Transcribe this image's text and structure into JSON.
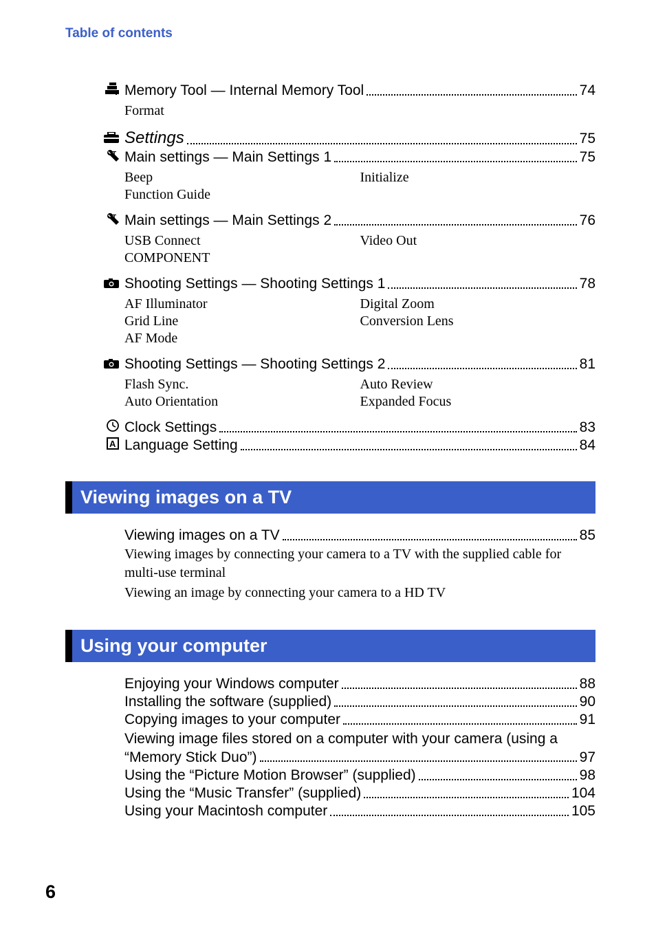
{
  "header": "Table of contents",
  "entries": [
    {
      "icon": "memory",
      "title": "Memory Tool — Internal Memory Tool",
      "page": "74",
      "subs_left": [
        "Format"
      ],
      "subs_right": []
    },
    {
      "icon": "toolbox",
      "title": "Settings",
      "page": "75",
      "italic": true
    },
    {
      "icon": "wrench",
      "title": "Main settings — Main Settings 1",
      "page": "75",
      "subs_left": [
        "Beep",
        "Function Guide"
      ],
      "subs_right": [
        "Initialize"
      ]
    },
    {
      "icon": "wrench",
      "title": "Main settings — Main Settings 2",
      "page": "76",
      "subs_left": [
        "USB Connect",
        "COMPONENT"
      ],
      "subs_right": [
        "Video Out"
      ]
    },
    {
      "icon": "camera",
      "title": "Shooting Settings — Shooting Settings 1",
      "page": "78",
      "subs_left": [
        "AF Illuminator",
        "Grid Line",
        "AF Mode"
      ],
      "subs_right": [
        "Digital Zoom",
        "Conversion Lens"
      ]
    },
    {
      "icon": "camera",
      "title": "Shooting Settings — Shooting Settings 2",
      "page": "81",
      "subs_left": [
        "Flash Sync.",
        "Auto Orientation"
      ],
      "subs_right": [
        "Auto Review",
        "Expanded Focus"
      ]
    },
    {
      "icon": "clock",
      "title": "Clock Settings",
      "page": "83"
    },
    {
      "icon": "lang",
      "title": "Language Setting",
      "page": "84"
    }
  ],
  "section_tv": {
    "heading": "Viewing images on a TV",
    "entry": {
      "title": "Viewing images on a TV",
      "page": "85"
    },
    "subs": [
      "Viewing images by connecting your camera to a TV with the supplied cable for multi-use terminal",
      "Viewing an image by connecting your camera to a HD TV"
    ]
  },
  "section_computer": {
    "heading": "Using your computer",
    "entries": [
      {
        "title": "Enjoying your Windows computer",
        "page": "88"
      },
      {
        "title": "Installing the software (supplied)",
        "page": "90"
      },
      {
        "title": "Copying images to your computer",
        "page": "91"
      }
    ],
    "multiline": {
      "line1": "Viewing image files stored on a computer with your camera (using a",
      "line2": "“Memory Stick Duo”)",
      "page": "97"
    },
    "entries2": [
      {
        "title": "Using the “Picture Motion Browser” (supplied)",
        "page": "98"
      },
      {
        "title": "Using the “Music Transfer” (supplied)",
        "page": "104"
      },
      {
        "title": "Using your Macintosh computer",
        "page": "105"
      }
    ]
  },
  "page_number": "6"
}
